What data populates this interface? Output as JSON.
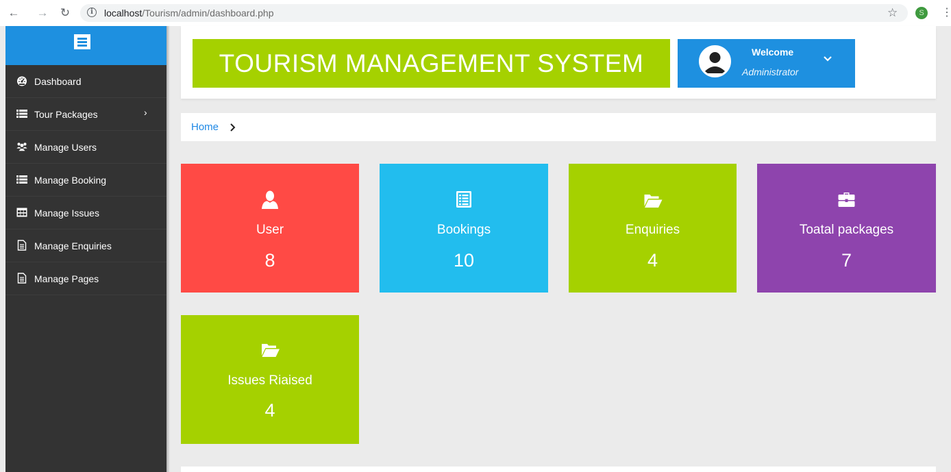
{
  "browser": {
    "url_host": "localhost",
    "url_path": "/Tourism/admin/dashboard.php",
    "profile_initial": "S"
  },
  "colors": {
    "sidebar_bg": "#333333",
    "accent_blue": "#1e90e0",
    "card_red": "#ff4a45",
    "card_cyan": "#22bdee",
    "card_green": "#a5d100",
    "card_purple": "#8e44ad"
  },
  "sidebar": {
    "toggle_icon": "hamburger-icon",
    "items": [
      {
        "label": "Dashboard",
        "icon": "dashboard-icon"
      },
      {
        "label": "Tour Packages",
        "icon": "list-icon",
        "has_submenu": true
      },
      {
        "label": "Manage Users",
        "icon": "users-icon"
      },
      {
        "label": "Manage Booking",
        "icon": "list-icon"
      },
      {
        "label": "Manage Issues",
        "icon": "table-icon"
      },
      {
        "label": "Manage Enquiries",
        "icon": "document-icon"
      },
      {
        "label": "Manage Pages",
        "icon": "document-icon"
      }
    ]
  },
  "header": {
    "title": "TOURISM MANAGEMENT SYSTEM",
    "welcome": "Welcome",
    "role": "Administrator"
  },
  "breadcrumb": {
    "home": "Home"
  },
  "cards": [
    {
      "title": "User",
      "value": "8",
      "icon": "user-icon",
      "color": "#ff4a45"
    },
    {
      "title": "Bookings",
      "value": "10",
      "icon": "list-alt-icon",
      "color": "#22bdee"
    },
    {
      "title": "Enquiries",
      "value": "4",
      "icon": "folder-open-icon",
      "color": "#a5d100"
    },
    {
      "title": "Toatal packages",
      "value": "7",
      "icon": "briefcase-icon",
      "color": "#8e44ad"
    },
    {
      "title": "Issues Riaised",
      "value": "4",
      "icon": "folder-open-icon",
      "color": "#a5d100"
    }
  ]
}
